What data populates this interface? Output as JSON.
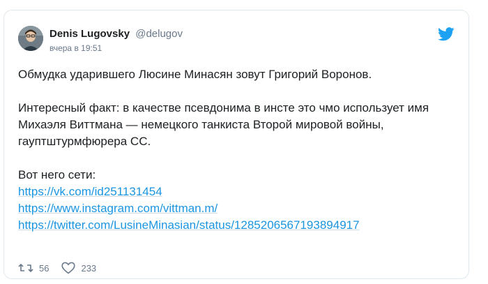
{
  "tweet": {
    "author_name": "Denis Lugovsky",
    "author_handle": "@delugov",
    "timestamp": "вчера в 19:51",
    "lines": {
      "p1": "Обмудка ударившего Люсине Минасян зовут Григорий Воронов.",
      "p2_l1": "Интересный факт: в качестве псевдонима в инсте это чмо использует имя",
      "p2_l2": "Михаэля Виттмана — немецкого танкиста Второй мировой войны,",
      "p2_l3": "гауптштурмфюрера СС.",
      "p3": "Вот него сети:"
    },
    "links": [
      "https://vk.com/id251131454",
      "https://www.instagram.com/vittman.m/",
      "https://twitter.com/LusineMinasian/status/1285206567193894917"
    ],
    "retweets": "56",
    "likes": "233"
  },
  "colors": {
    "link": "#1b95e0",
    "twitter_blue": "#1da1f2",
    "muted": "#69788a"
  },
  "icons": [
    "avatar",
    "twitter-logo-icon",
    "retweet-icon",
    "like-icon"
  ]
}
